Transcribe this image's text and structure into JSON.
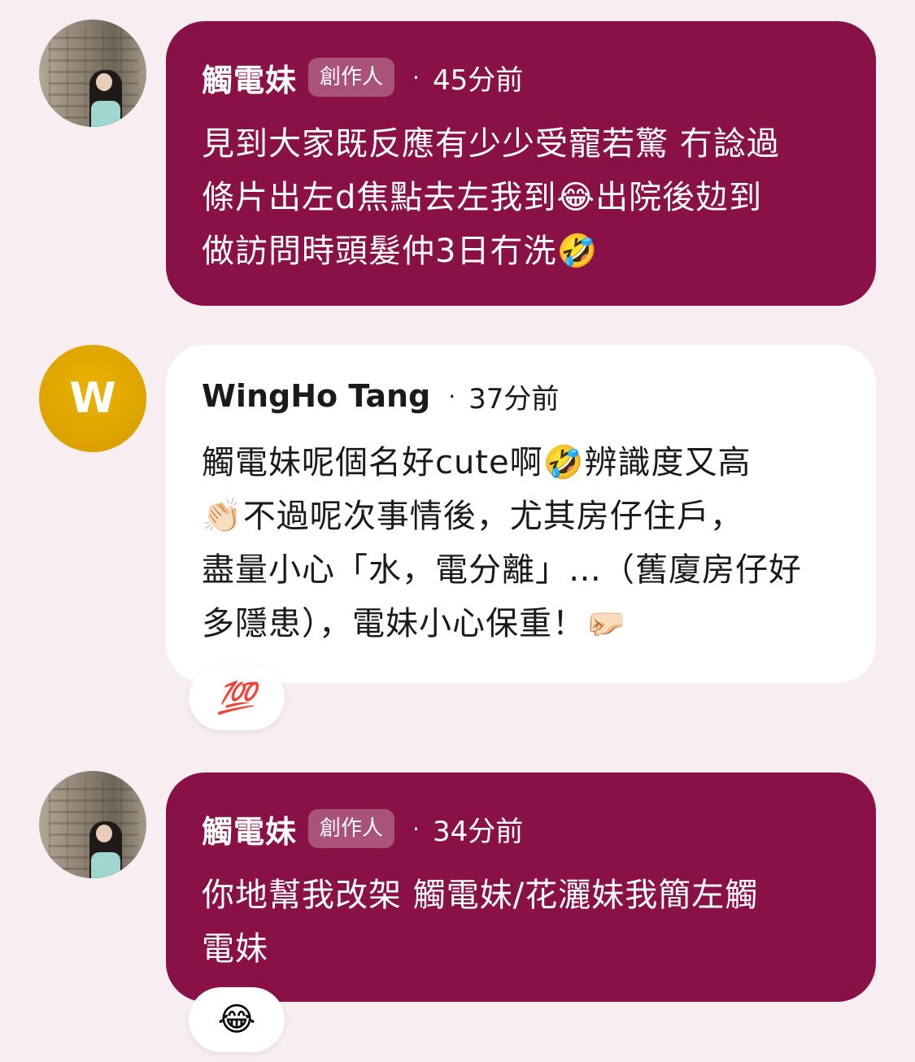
{
  "comments": [
    {
      "author": "觸電妹",
      "badge": "創作人",
      "separator": "·",
      "time": "45分前",
      "text": "見到大家既反應有少少受寵若驚 冇諗過\n條片出左d焦點去左我到😂出院後攰到\n做訪問時頭髮仲3日冇洗🤣"
    },
    {
      "author": "WingHo Tang",
      "avatar_letter": "W",
      "separator": "·",
      "time": "37分前",
      "text": "觸電妹呢個名好cute啊🤣辨識度又高\n👏🏻不過呢次事情後，尤其房仔住戶，\n盡量小心「水，電分離」…（舊廈房仔好\n多隱患），電妹小心保重！🤛🏻",
      "reaction": "💯"
    },
    {
      "author": "觸電妹",
      "badge": "創作人",
      "separator": "·",
      "time": "34分前",
      "text": "你地幫我改架 觸電妹/花灑妹我簡左觸\n電妹",
      "reaction": "😂"
    }
  ],
  "colors": {
    "page_background": "#f8eef1",
    "creator_bubble": "#8a1147",
    "plain_bubble": "#ffffff",
    "avatar_gold": "#e0a800"
  }
}
